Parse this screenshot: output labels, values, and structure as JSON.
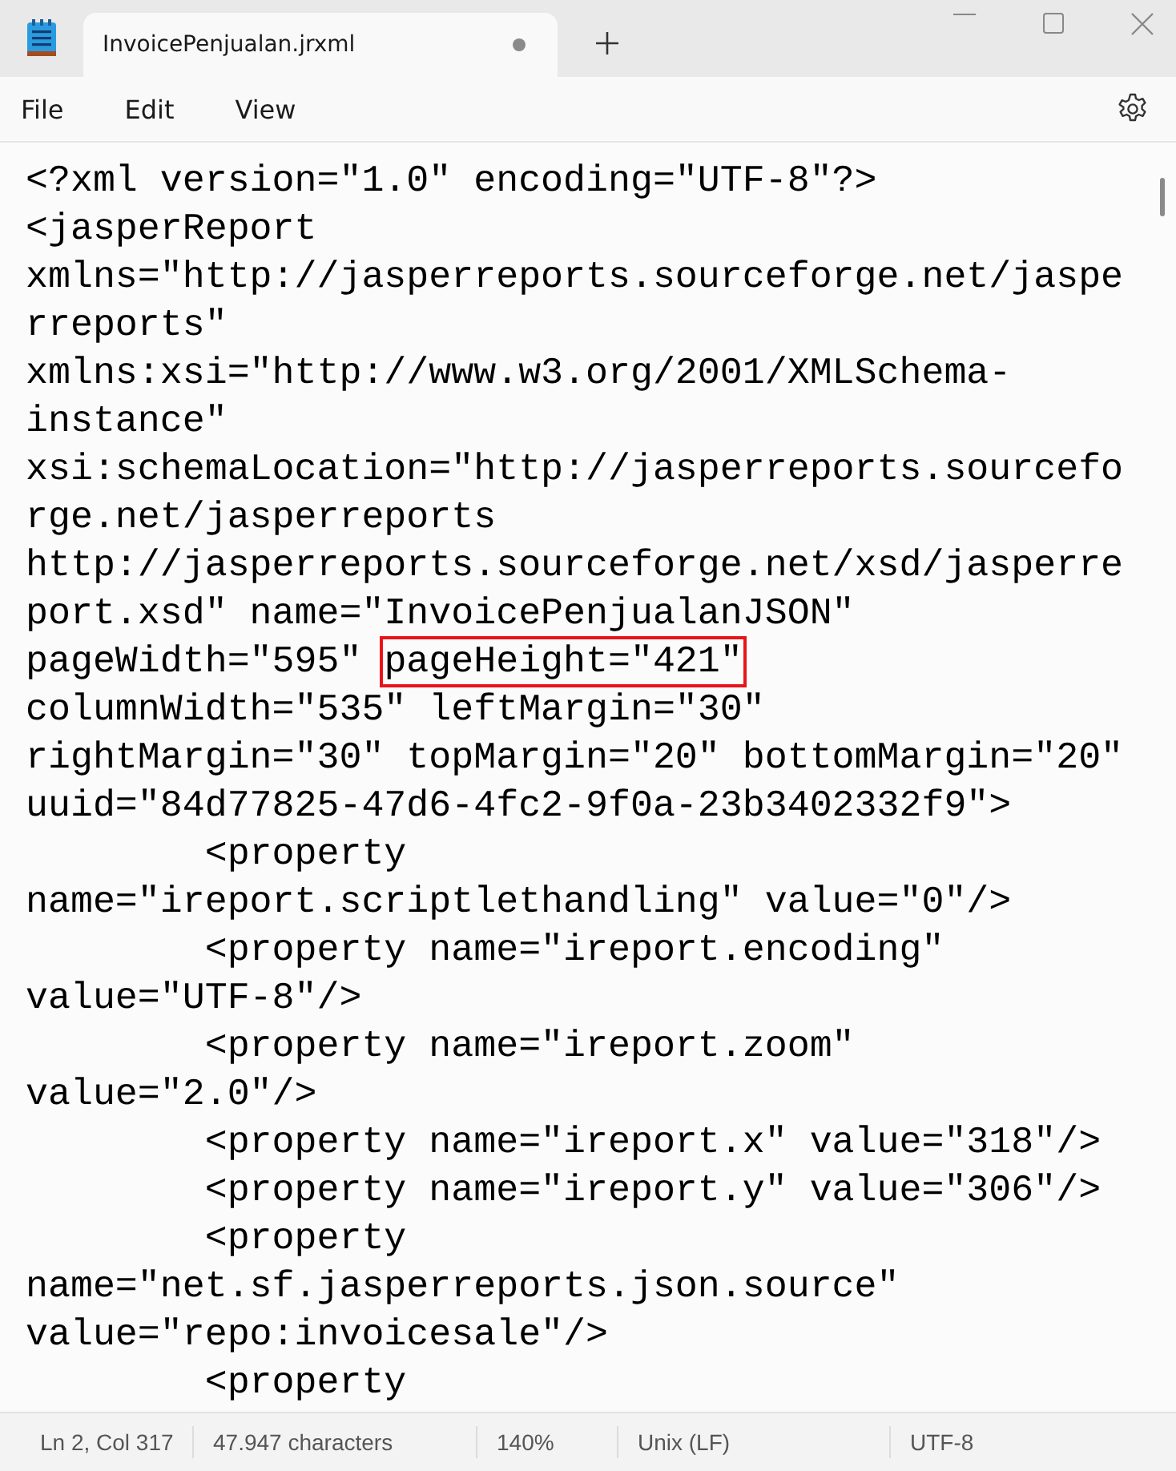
{
  "window": {
    "tab": {
      "title": "InvoicePenjualan.jrxml",
      "modified": true
    }
  },
  "menu": [
    "File",
    "Edit",
    "View"
  ],
  "editor": {
    "lines": [
      {
        "text": "<?xml version=\"1.0\" encoding=\"UTF-8\"?>"
      },
      {
        "text": "<jasperReport"
      },
      {
        "text": "xmlns=\"http://jasperreports.sourceforge.net/jaspe"
      },
      {
        "text": "rreports\""
      },
      {
        "text": "xmlns:xsi=\"http://www.w3.org/2001/XMLSchema-"
      },
      {
        "text": "instance\""
      },
      {
        "text": "xsi:schemaLocation=\"http://jasperreports.sourcefo"
      },
      {
        "text": "rge.net/jasperreports"
      },
      {
        "text": "http://jasperreports.sourceforge.net/xsd/jasperre"
      },
      {
        "text": "port.xsd\" name=\"InvoicePenjualanJSON\""
      },
      {
        "text": "pageWidth=\"595\" ",
        "boxed": "pageHeight=\"421\""
      },
      {
        "text": "columnWidth=\"535\" leftMargin=\"30\""
      },
      {
        "text": "rightMargin=\"30\" topMargin=\"20\" bottomMargin=\"20\""
      },
      {
        "text": "uuid=\"84d77825-47d6-4fc2-9f0a-23b3402332f9\">"
      },
      {
        "text": "        <property"
      },
      {
        "text": "name=\"ireport.scriptlethandling\" value=\"0\"/>"
      },
      {
        "text": "        <property name=\"ireport.encoding\""
      },
      {
        "text": "value=\"UTF-8\"/>"
      },
      {
        "text": "        <property name=\"ireport.zoom\""
      },
      {
        "text": "value=\"2.0\"/>"
      },
      {
        "text": "        <property name=\"ireport.x\" value=\"318\"/>"
      },
      {
        "text": "        <property name=\"ireport.y\" value=\"306\"/>"
      },
      {
        "text": "        <property"
      },
      {
        "text": "name=\"net.sf.jasperreports.json.source\""
      },
      {
        "text": "value=\"repo:invoicesale\"/>"
      },
      {
        "text": "        <property"
      }
    ]
  },
  "status_bar": [
    "Ln 2, Col 317",
    "47.947 characters",
    "140%",
    "Unix (LF)",
    "UTF-8"
  ]
}
